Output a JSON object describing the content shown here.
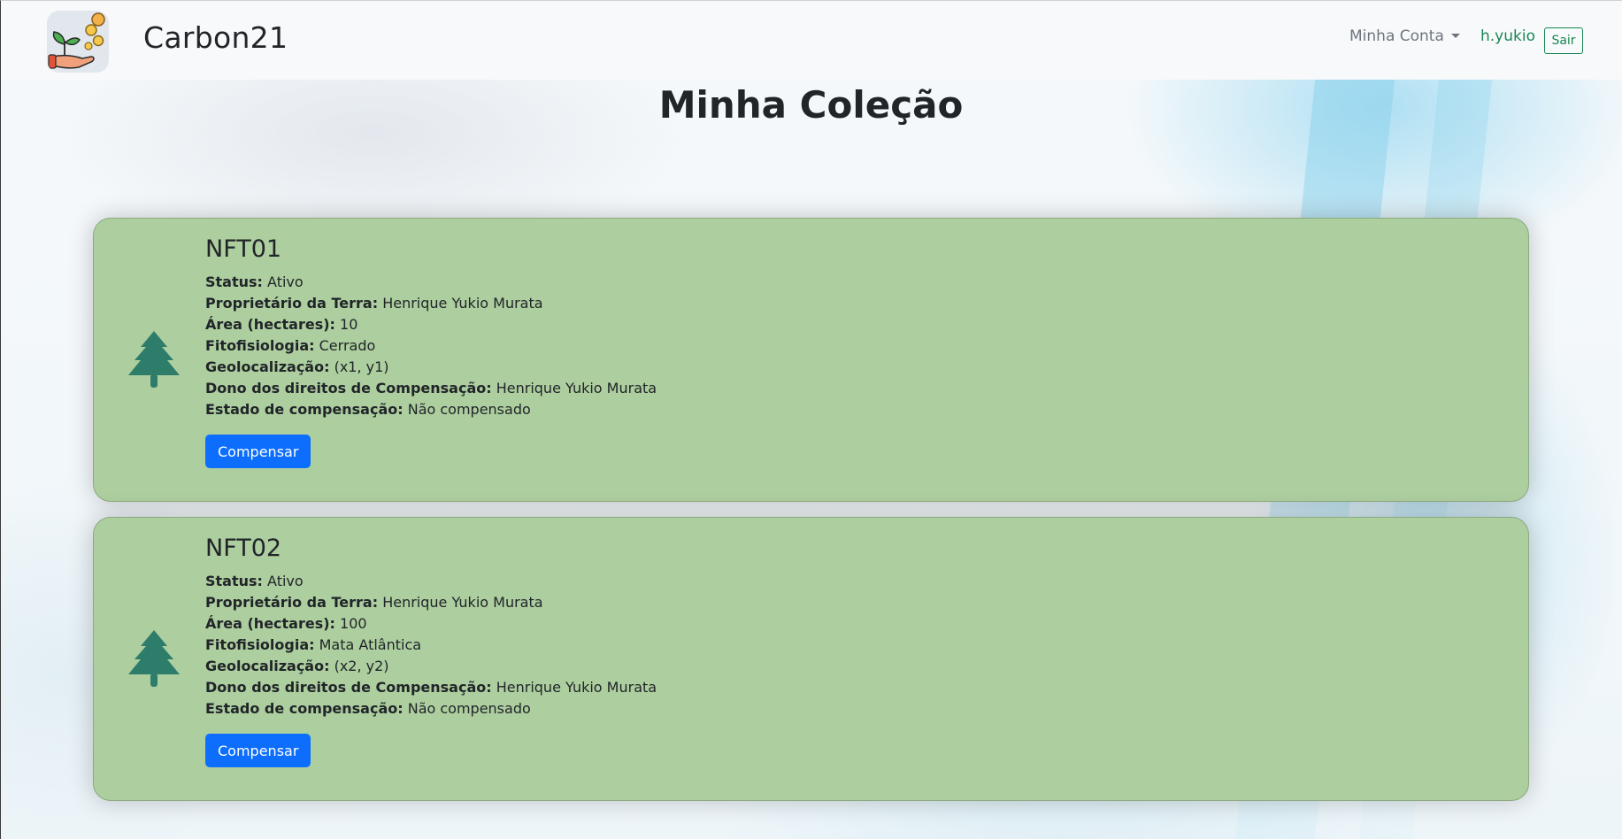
{
  "brand": {
    "name": "Carbon21",
    "logo_icon": "plant-hand-coins-logo"
  },
  "nav": {
    "account_label": "Minha Conta",
    "username": "h.yukio",
    "logout_label": "Sair"
  },
  "colors": {
    "card_bg": "#adce9f",
    "primary": "#0d6efd",
    "success": "#198754",
    "tree_icon": "#2e7d6b"
  },
  "page": {
    "title": "Minha Coleção"
  },
  "labels": {
    "status": "Status:",
    "owner": "Proprietário da Terra:",
    "area": "Área (hectares):",
    "phyto": "Fitofisiologia:",
    "geo": "Geolocalização:",
    "rights": "Dono dos direitos de Compensação:",
    "comp_state": "Estado de compensação:"
  },
  "cards": [
    {
      "icon": "tree-icon",
      "title": "NFT01",
      "status": "Ativo",
      "owner": "Henrique Yukio Murata",
      "area": "10",
      "phyto": "Cerrado",
      "geo": "(x1, y1)",
      "rights": "Henrique Yukio Murata",
      "comp_state": "Não compensado",
      "button_label": "Compensar"
    },
    {
      "icon": "tree-icon",
      "title": "NFT02",
      "status": "Ativo",
      "owner": "Henrique Yukio Murata",
      "area": "100",
      "phyto": "Mata Atlântica",
      "geo": "(x2, y2)",
      "rights": "Henrique Yukio Murata",
      "comp_state": "Não compensado",
      "button_label": "Compensar"
    }
  ]
}
